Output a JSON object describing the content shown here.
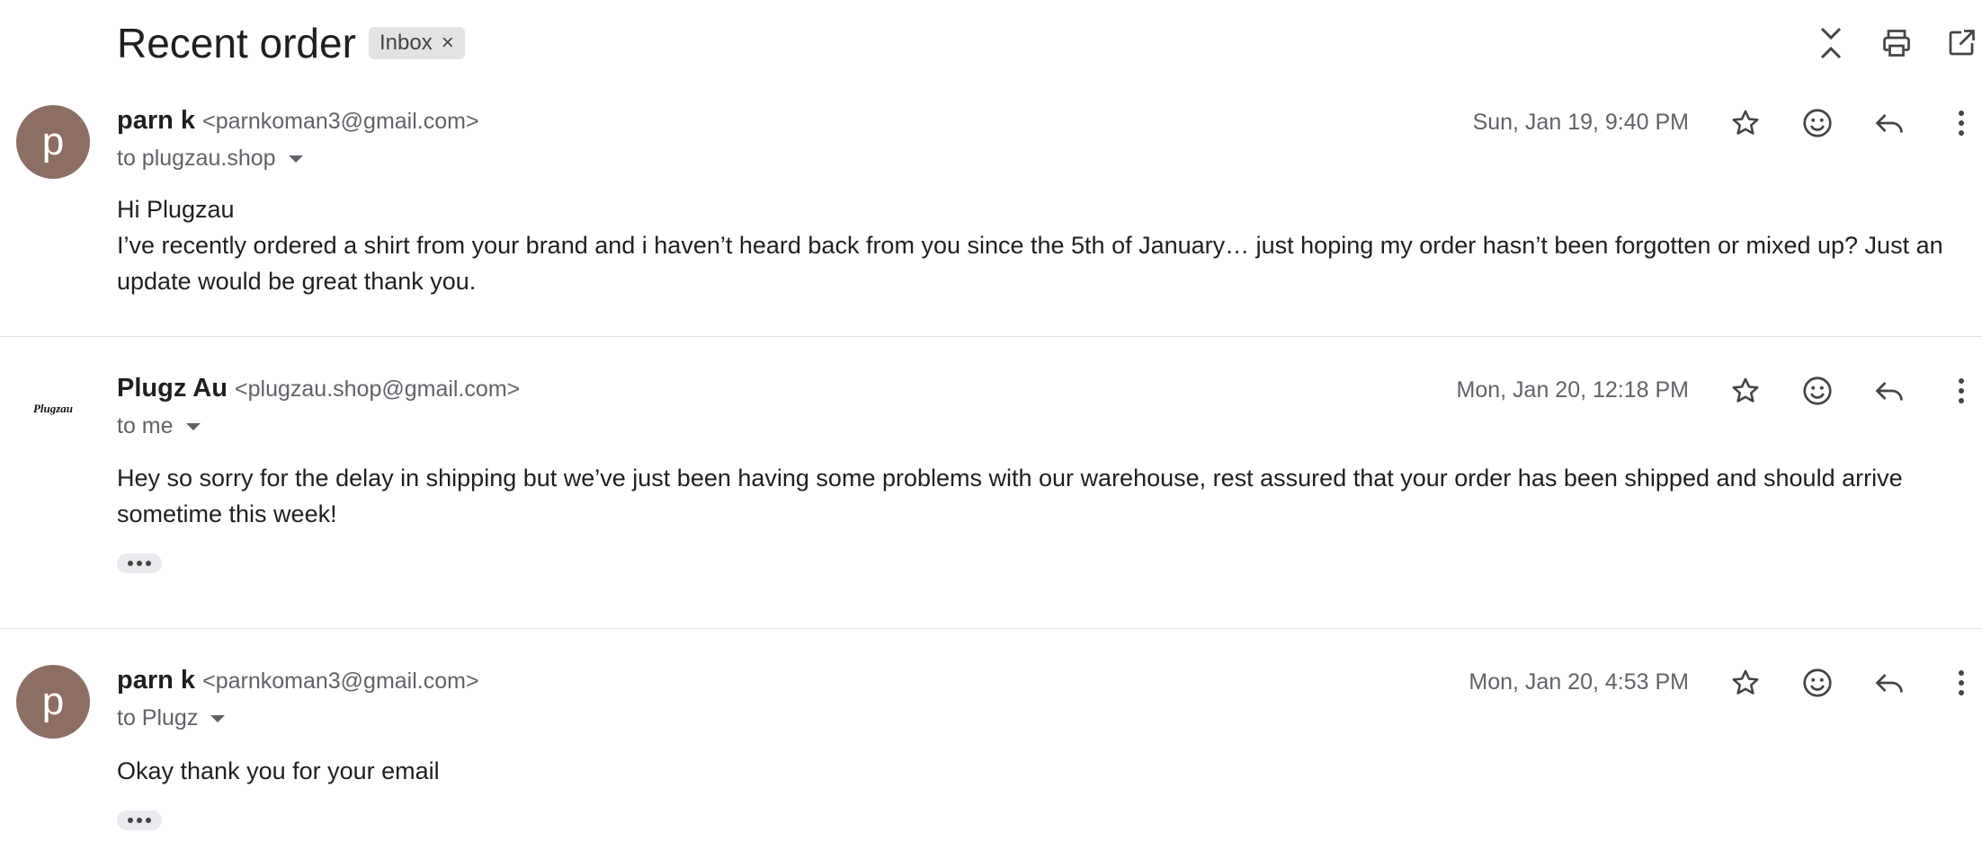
{
  "thread": {
    "subject": "Recent order",
    "label": "Inbox",
    "label_remove": "×"
  },
  "header_icons": [
    "collapse-all-icon",
    "print-icon",
    "open-in-new-window-icon"
  ],
  "messages": [
    {
      "avatar_letter": "p",
      "sender_name": "parn k",
      "sender_email": "<parnkoman3@gmail.com>",
      "to": "to plugzau.shop",
      "date": "Sun, Jan 19, 9:40 PM",
      "body": [
        "Hi Plugzau",
        "I’ve recently ordered a shirt from your brand and i haven’t heard back from you since the 5th of January… just hoping my order hasn’t been forgotten or mixed up? Just an update would be great thank you."
      ]
    },
    {
      "avatar_logo": "Plugzau",
      "sender_name": "Plugz Au",
      "sender_email": "<plugzau.shop@gmail.com>",
      "to": "to me",
      "date": "Mon, Jan 20, 12:18 PM",
      "body": [
        "Hey so sorry for the delay in shipping but we’ve just been having some problems with our warehouse, rest assured that your order has been shipped and should arrive sometime this week!"
      ]
    },
    {
      "avatar_letter": "p",
      "sender_name": "parn k",
      "sender_email": "<parnkoman3@gmail.com>",
      "to": "to Plugz",
      "date": "Mon, Jan 20, 4:53 PM",
      "body": [
        "Okay thank you for your email"
      ]
    }
  ],
  "message_actions": [
    "star-icon",
    "add-reaction-icon",
    "reply-icon",
    "more-vert-icon"
  ],
  "colors": {
    "avatar": "#8d6e63",
    "chip": "#e3e3e3",
    "secondary_text": "#5f6368"
  }
}
